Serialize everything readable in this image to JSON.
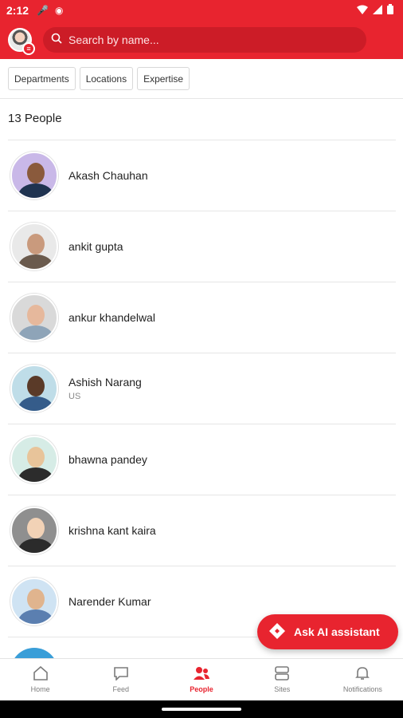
{
  "status_bar": {
    "time": "2:12"
  },
  "header": {
    "search_placeholder": "Search by name..."
  },
  "filters": [
    {
      "label": "Departments"
    },
    {
      "label": "Locations"
    },
    {
      "label": "Expertise"
    }
  ],
  "people_count": "13 People",
  "people": [
    {
      "name": "Akash Chauhan",
      "location": ""
    },
    {
      "name": "ankit gupta",
      "location": ""
    },
    {
      "name": "ankur khandelwal",
      "location": ""
    },
    {
      "name": "Ashish Narang",
      "location": "US"
    },
    {
      "name": "bhawna pandey",
      "location": ""
    },
    {
      "name": "krishna kant kaira",
      "location": ""
    },
    {
      "name": "Narender Kumar",
      "location": ""
    }
  ],
  "fab": {
    "label": "Ask AI assistant"
  },
  "nav": [
    {
      "label": "Home",
      "icon": "home-icon"
    },
    {
      "label": "Feed",
      "icon": "feed-icon"
    },
    {
      "label": "People",
      "icon": "people-icon",
      "active": true
    },
    {
      "label": "Sites",
      "icon": "sites-icon"
    },
    {
      "label": "Notifications",
      "icon": "bell-icon"
    }
  ],
  "colors": {
    "brand": "#e8242f",
    "brand_dark": "#cc1c27"
  }
}
